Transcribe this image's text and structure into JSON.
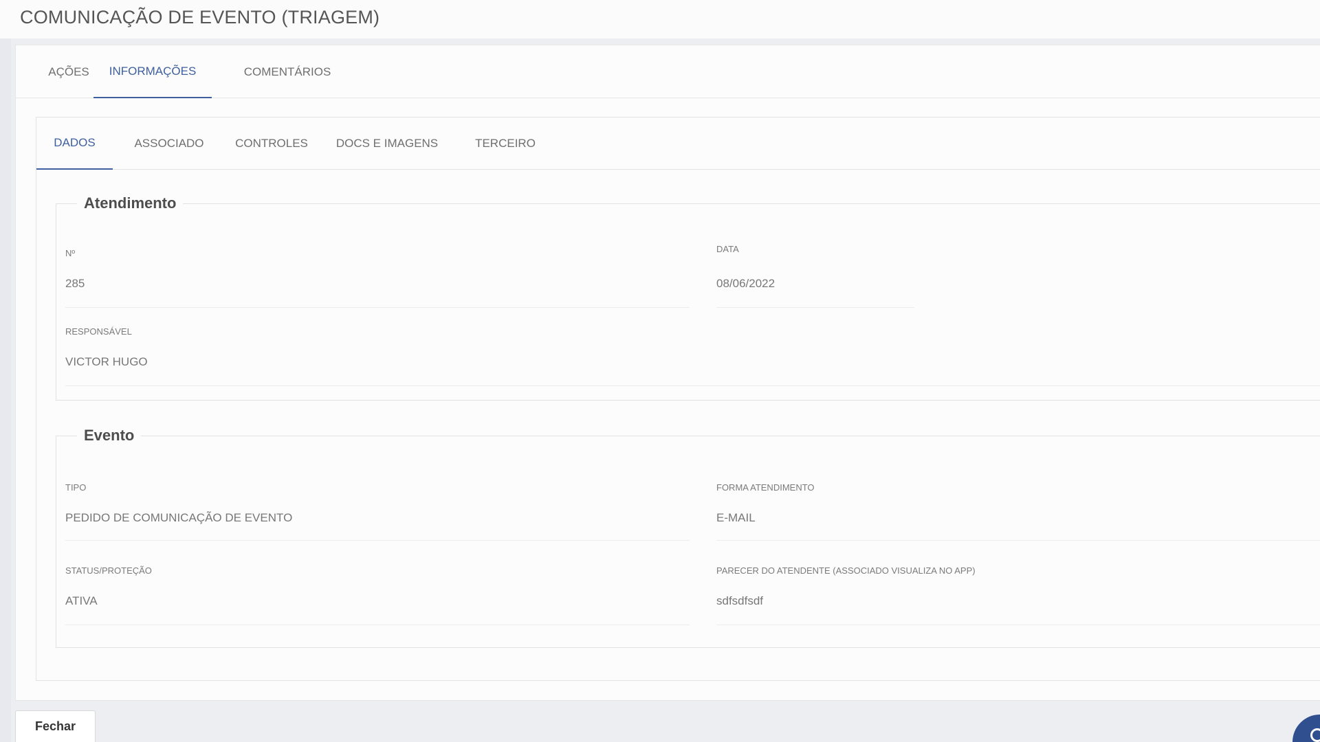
{
  "page": {
    "title": "COMUNICAÇÃO DE EVENTO (TRIAGEM)"
  },
  "outer_tabs": [
    {
      "label": "AÇÕES",
      "active": false
    },
    {
      "label": "INFORMAÇÕES",
      "active": true
    },
    {
      "label": "COMENTÁRIOS",
      "active": false
    }
  ],
  "inner_tabs": [
    {
      "label": "DADOS",
      "active": true
    },
    {
      "label": "ASSOCIADO",
      "active": false
    },
    {
      "label": "CONTROLES",
      "active": false
    },
    {
      "label": "DOCS E IMAGENS",
      "active": false
    },
    {
      "label": "TERCEIRO",
      "active": false
    }
  ],
  "atendimento": {
    "title": "Atendimento",
    "numero": {
      "label": "Nº",
      "value": "285"
    },
    "data": {
      "label": "DATA",
      "value": "08/06/2022"
    },
    "responsavel": {
      "label": "RESPONSÁVEL",
      "value": "VICTOR HUGO"
    }
  },
  "evento": {
    "title": "Evento",
    "tipo": {
      "label": "TIPO",
      "value": "PEDIDO DE COMUNICAÇÃO DE EVENTO"
    },
    "forma_atendimento": {
      "label": "FORMA ATENDIMENTO",
      "value": "E-MAIL"
    },
    "status": {
      "label": "STATUS/PROTEÇÃO",
      "value": "ATIVA"
    },
    "parecer": {
      "label": "PARECER DO ATENDENTE (ASSOCIADO VISUALIZA NO APP)",
      "value": "sdfsdfsdf"
    }
  },
  "footer": {
    "close_label": "Fechar"
  },
  "colors": {
    "accent": "#3e5f9f",
    "chat_bubble": "#2f4f8f"
  }
}
